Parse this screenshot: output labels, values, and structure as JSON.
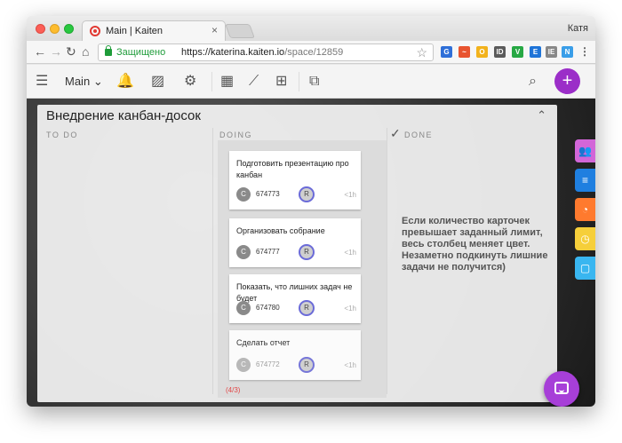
{
  "browser": {
    "tab_title": "Main | Kaiten",
    "user_name": "Катя",
    "secure_label": "Защищено",
    "url_host": "https://katerina.kaiten.io",
    "url_path": "/space/12859"
  },
  "appbar": {
    "space_name": "Main"
  },
  "board": {
    "title": "Внедрение канбан-досок",
    "columns": [
      "TO DO",
      "DOING",
      "DONE"
    ],
    "wip_count": "(4/3)",
    "cards": [
      {
        "title": "Подготовить презентацию про канбан",
        "id": "674773",
        "assignee": "C",
        "member": "R",
        "time": "<1h"
      },
      {
        "title": "Организовать собрание",
        "id": "674777",
        "assignee": "C",
        "member": "R",
        "time": "<1h"
      },
      {
        "title": "Показать, что лишних задач не будет",
        "id": "674780",
        "assignee": "C",
        "member": "R",
        "time": "<1h"
      },
      {
        "title": "Сделать отчет",
        "id": "674772",
        "assignee": "C",
        "member": "R",
        "time": "<1h"
      }
    ],
    "note": "Если количество карточек превышает заданный лимит, весь столбец меняет цвет. Незаметно подкинуть лишние задачи не получится)"
  },
  "colors": {
    "accent": "#9b2ec8",
    "wip_exceeded": "#e24747",
    "rail": [
      "#d266d8",
      "#1f7fe0",
      "#ff7a2e",
      "#f6cf3a",
      "#39b6f0"
    ]
  }
}
